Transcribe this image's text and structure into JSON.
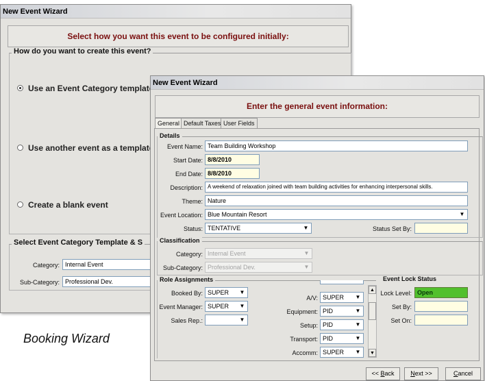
{
  "caption": "Booking Wizard",
  "back_window": {
    "title": "New Event Wizard",
    "banner": "Select how you want this event to be configured initially:",
    "create_group_title": "How do you want to create this event?",
    "options": [
      {
        "label": "Use an Event Category template",
        "selected": true
      },
      {
        "label": "Use another event as a template",
        "selected": false
      },
      {
        "label": "Create a blank event",
        "selected": false
      }
    ],
    "template_group_title": "Select Event Category Template & S",
    "category_label": "Category:",
    "category_value": "Internal Event",
    "subcategory_label": "Sub-Category:",
    "subcategory_value": "Professional Dev."
  },
  "front_window": {
    "title": "New Event Wizard",
    "banner": "Enter the general event information:",
    "tabs": [
      "General",
      "Default Taxes",
      "User Fields"
    ],
    "details": {
      "title": "Details",
      "event_name_label": "Event Name:",
      "event_name": "Team Building Workshop",
      "start_date_label": "Start Date:",
      "start_date": "8/8/2010",
      "end_date_label": "End Date:",
      "end_date": "8/8/2010",
      "description_label": "Description:",
      "description": "A weekend of relaxation joined with team building activities for enhancing interpersonal skills.",
      "theme_label": "Theme:",
      "theme": "Nature",
      "location_label": "Event Location:",
      "location": "Blue Mountain Resort",
      "status_label": "Status:",
      "status": "TENTATIVE",
      "status_set_by_label": "Status Set By:",
      "status_set_by": ""
    },
    "classification": {
      "title": "Classification",
      "category_label": "Category:",
      "category": "Internal Event",
      "subcategory_label": "Sub-Category:",
      "subcategory": "Professional Dev."
    },
    "roles": {
      "title": "Role Assignments",
      "booked_by_label": "Booked By:",
      "booked_by": "SUPER",
      "event_manager_label": "Event Manager:",
      "event_manager": "SUPER",
      "sales_rep_label": "Sales Rep.:",
      "sales_rep": "",
      "av_label": "A/V:",
      "av": "SUPER",
      "equipment_label": "Equipment:",
      "equipment": "PID",
      "setup_label": "Setup:",
      "setup": "PID",
      "transport_label": "Transport:",
      "transport": "PID",
      "accomm_label": "Accomm:",
      "accomm": "SUPER"
    },
    "lock": {
      "title": "Event Lock Status",
      "lock_level_label": "Lock Level:",
      "lock_level": "Open",
      "set_by_label": "Set By:",
      "set_by": "",
      "set_on_label": "Set On:",
      "set_on": ""
    },
    "buttons": {
      "back_prefix": "<< ",
      "back_underlined": "B",
      "back_rest": "ack",
      "next_underlined": "N",
      "next_rest": "ext >>",
      "cancel_underlined": "C",
      "cancel_rest": "ancel"
    }
  },
  "colors": {
    "banner_text": "#7a0f0f",
    "lock_open": "#52c02d",
    "date_field": "#fffde3"
  }
}
